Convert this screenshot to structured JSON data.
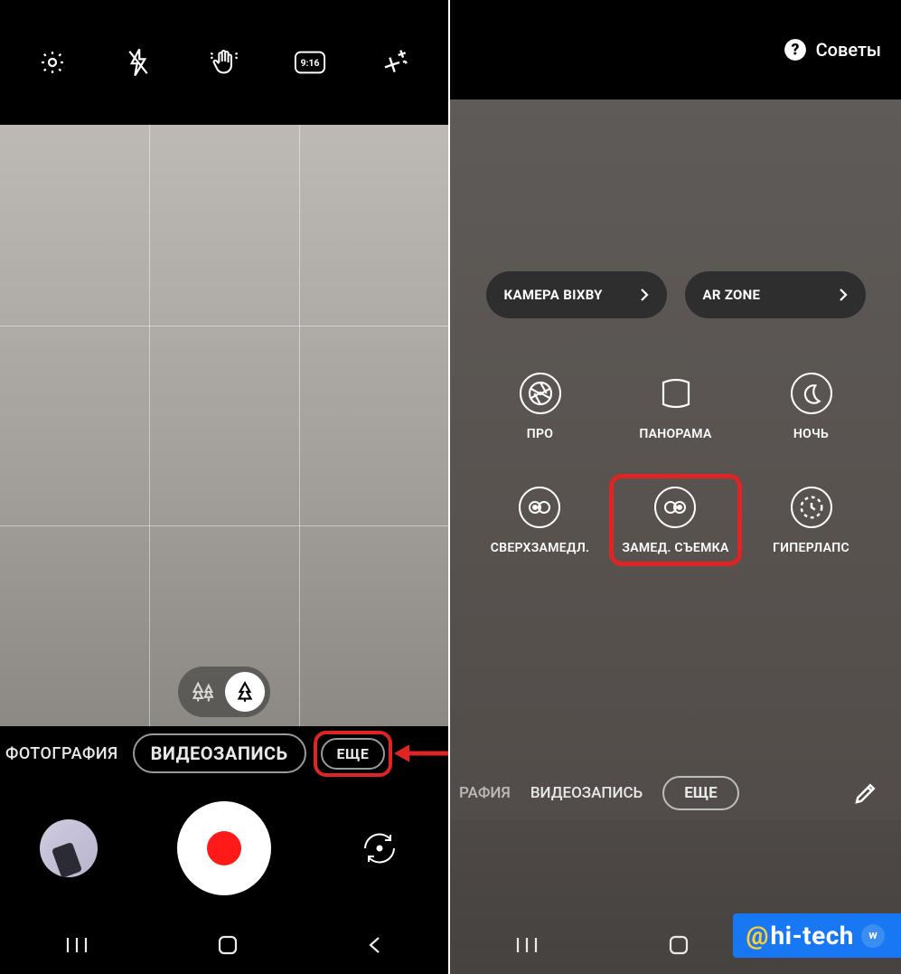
{
  "left": {
    "top_icons": {
      "settings": "settings",
      "flash": "flash-off",
      "gesture": "palm-gesture",
      "ratio_text": "9:16",
      "filter": "magic-filter"
    },
    "modes": {
      "photo": "ФОТОГРАФИЯ",
      "video": "ВИДЕОЗАПИСЬ",
      "more": "ЕЩЕ"
    }
  },
  "right": {
    "tips": "Советы",
    "pills": {
      "bixby": "КАМЕРА BIXBY",
      "arzone": "AR ZONE"
    },
    "grid": {
      "pro": "ПРО",
      "panorama": "ПАНОРАМА",
      "night": "НОЧЬ",
      "super_slow": "СВЕРХЗАМЕДЛ.",
      "slow_mo": "ЗАМЕД. СЪЕМКА",
      "hyperlapse": "ГИПЕРЛАПС"
    },
    "modes": {
      "photo_partial": "РАФИЯ",
      "video": "ВИДЕОЗАПИСЬ",
      "more": "ЕЩЕ"
    }
  },
  "watermark": {
    "at": "@",
    "text": "hi-tech"
  }
}
